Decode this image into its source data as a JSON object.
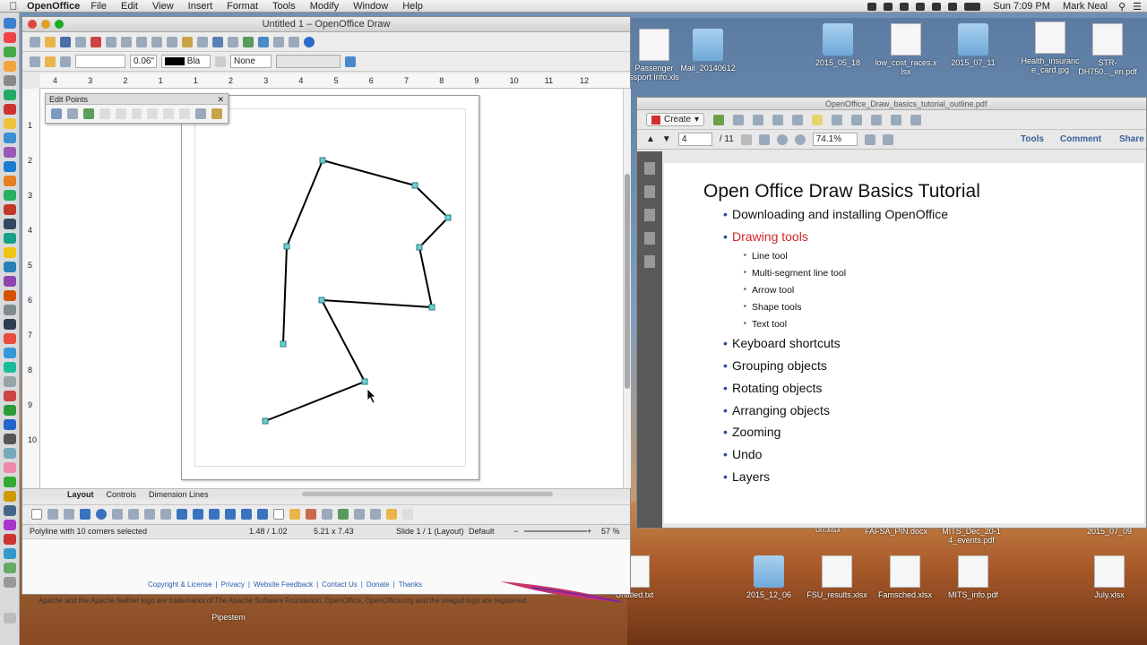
{
  "menubar": {
    "app_name": "OpenOffice",
    "items": [
      "File",
      "Edit",
      "View",
      "Insert",
      "Format",
      "Tools",
      "Modify",
      "Window",
      "Help"
    ],
    "clock": "Sun 7:09 PM",
    "user": "Mark Neal"
  },
  "draw_window": {
    "title": "Untitled 1 – OpenOffice Draw",
    "line_width": "0.06\"",
    "line_color": "Bla",
    "area_style": "None",
    "ruler_top": [
      "4",
      "3",
      "2",
      "1",
      "1",
      "2",
      "3",
      "4",
      "5",
      "6",
      "7",
      "8",
      "9",
      "10",
      "11",
      "12"
    ],
    "ruler_left": [
      "1",
      "2",
      "3",
      "4",
      "5",
      "6",
      "7",
      "8",
      "9",
      "10"
    ],
    "edit_points_title": "Edit Points",
    "tabs": [
      "Layout",
      "Controls",
      "Dimension Lines"
    ],
    "status": {
      "selection": "Polyline with 10 corners selected",
      "position": "1.48 / 1.02",
      "size": "5.21 x 7.43",
      "slide": "Slide 1 / 1 (Layout)",
      "style": "Default",
      "zoom": "57 %"
    },
    "footer_links": [
      "Copyright & License",
      "Privacy",
      "Website Feedback",
      "Contact Us",
      "Donate",
      "Thanks"
    ],
    "footer_note": "Apache and the Apache feather logo are trademarks of The Apache Software Foundation. OpenOffice, OpenOffice.org and the seagull logo are registered",
    "accent": "#2a5db0"
  },
  "pdf_window": {
    "title": "OpenOffice_Draw_basics_tutorial_outline.pdf",
    "create_label": "Create",
    "page_current": "4",
    "page_total": "/ 11",
    "zoom": "74.1%",
    "tools_label": "Tools",
    "comment_label": "Comment",
    "share_label": "Share",
    "slide_title": "Open Office Draw Basics Tutorial",
    "bullets": [
      "Downloading and installing OpenOffice",
      "Drawing tools",
      "Keyboard shortcuts",
      "Grouping objects",
      "Rotating objects",
      "Arranging objects",
      "Zooming",
      "Undo",
      "Layers"
    ],
    "sub_bullets": [
      "Line tool",
      "Multi-segment line tool",
      "Arrow tool",
      "Shape tools",
      "Text tool"
    ],
    "highlight_color": "#d0262a"
  },
  "desktop": {
    "icons_top": [
      {
        "label": "Passenger\nssport Info.xls",
        "kind": "doc"
      },
      {
        "label": "Mail_20140612",
        "kind": "folder"
      },
      {
        "label": "2015_05_18",
        "kind": "folder"
      },
      {
        "label": "low_cost_races.x\nlsx",
        "kind": "doc"
      },
      {
        "label": "2015_07_11",
        "kind": "folder"
      },
      {
        "label": "Health_insuranc\ne_card.jpg",
        "kind": "doc"
      },
      {
        "label": "STR-\nDH750..._en.pdf",
        "kind": "doc"
      }
    ],
    "icons_bottom": [
      {
        "label": "on.xlsx",
        "kind": "doc"
      },
      {
        "label": "FAFSA_PIN.docx",
        "kind": "doc"
      },
      {
        "label": "MITS_Dec_20-1\n4_events.pdf",
        "kind": "doc"
      },
      {
        "label": "2015_07_09",
        "kind": "folder"
      },
      {
        "label": "Untitled.txt",
        "kind": "doc"
      },
      {
        "label": "2015_12_06",
        "kind": "folder"
      },
      {
        "label": "FSU_results.xlsx",
        "kind": "doc"
      },
      {
        "label": "Famsched.xlsx",
        "kind": "doc"
      },
      {
        "label": "MITS_info.pdf",
        "kind": "doc"
      },
      {
        "label": "July.xlsx",
        "kind": "doc"
      },
      {
        "label": "Pipestem",
        "kind": "folder"
      }
    ]
  }
}
